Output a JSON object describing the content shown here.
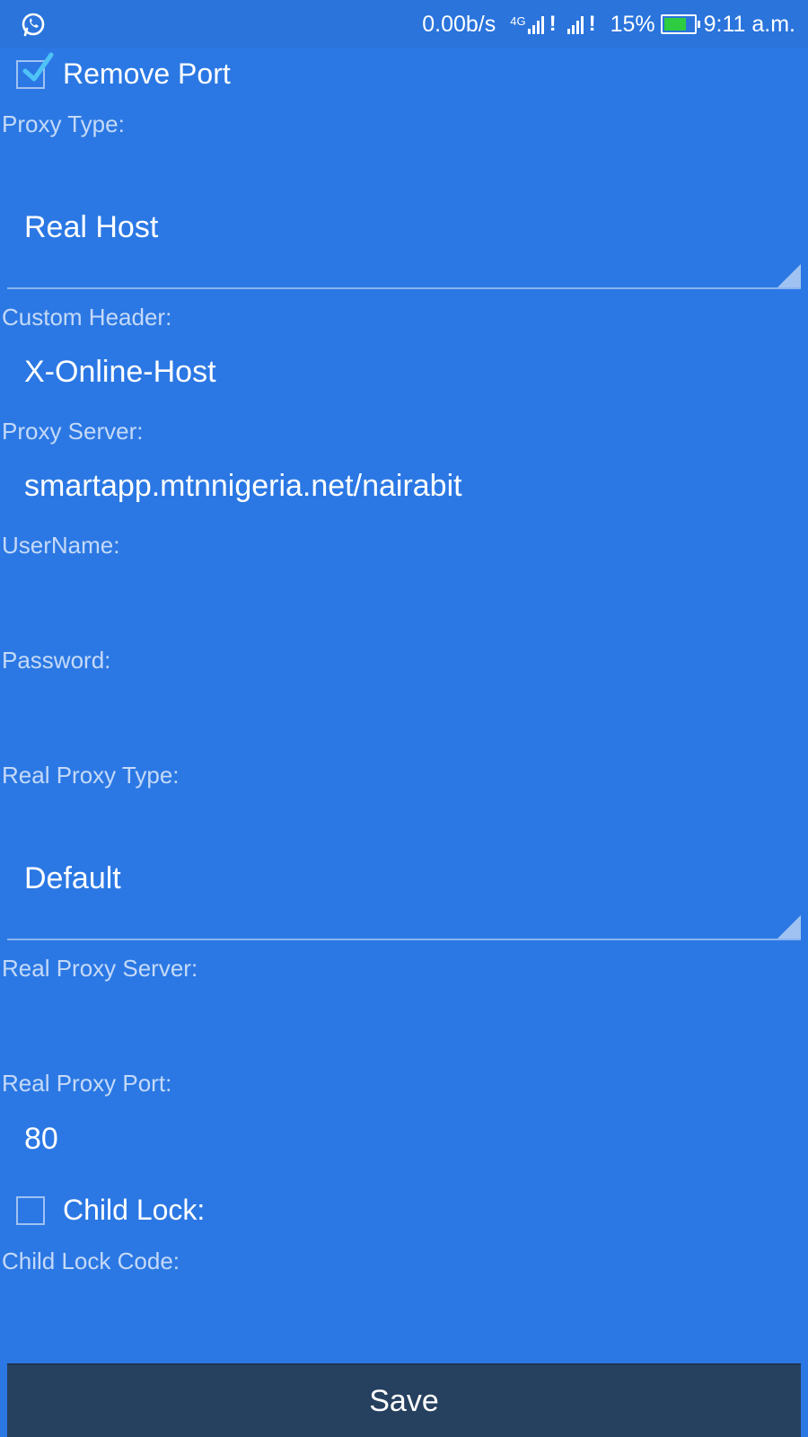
{
  "status_bar": {
    "net_speed": "0.00b/s",
    "network_type": "4G",
    "signal_alert": "!",
    "battery_percent": "15%",
    "time": "9:11 a.m."
  },
  "form": {
    "remove_port": {
      "label": "Remove Port",
      "checked": true
    },
    "proxy_type": {
      "label": "Proxy Type:",
      "value": "Real Host"
    },
    "custom_header": {
      "label": "Custom Header:",
      "value": "X-Online-Host"
    },
    "proxy_server": {
      "label": "Proxy Server:",
      "value": "smartapp.mtnnigeria.net/nairabit"
    },
    "username": {
      "label": "UserName:",
      "value": ""
    },
    "password": {
      "label": "Password:",
      "value": ""
    },
    "real_proxy_type": {
      "label": "Real Proxy Type:",
      "value": "Default"
    },
    "real_proxy_server": {
      "label": "Real Proxy Server:",
      "value": ""
    },
    "real_proxy_port": {
      "label": "Real Proxy Port:",
      "value": "80"
    },
    "child_lock": {
      "label": "Child Lock:",
      "checked": false
    },
    "child_lock_code": {
      "label": "Child Lock Code:",
      "value": ""
    }
  },
  "actions": {
    "save_label": "Save"
  },
  "colors": {
    "background": "#2b78e4",
    "status_bar": "#2a74dc",
    "save_button": "#26405f",
    "battery_fill": "#2ecc40",
    "check_accent": "#4fc3f7"
  }
}
